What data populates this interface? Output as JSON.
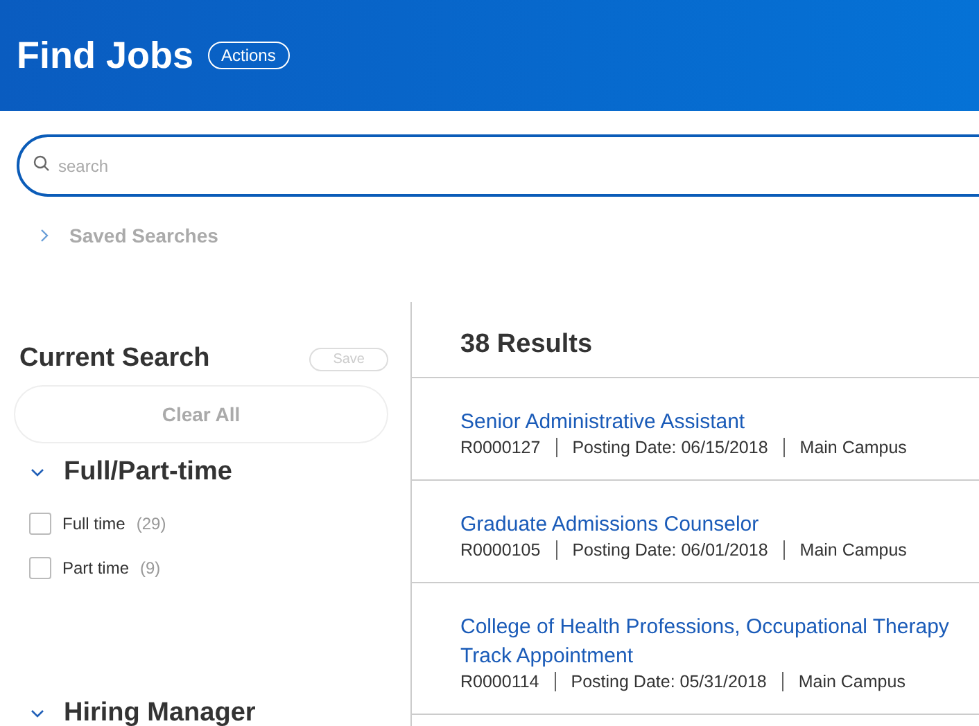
{
  "header": {
    "title": "Find Jobs",
    "actions_button": "Actions"
  },
  "search": {
    "placeholder": "search"
  },
  "saved_searches": {
    "label": "Saved Searches",
    "expanded": false
  },
  "current_search": {
    "title": "Current Search",
    "save_button": "Save",
    "clear_button": "Clear All"
  },
  "facets": [
    {
      "title": "Full/Part-time",
      "expanded": true,
      "options": [
        {
          "label": "Full time",
          "count": "(29)",
          "checked": false
        },
        {
          "label": "Part time",
          "count": "(9)",
          "checked": false
        }
      ]
    },
    {
      "title": "Hiring Manager",
      "expanded": true
    }
  ],
  "results": {
    "count": "38 Results",
    "jobs": [
      {
        "title": "Senior Administrative Assistant",
        "meta": [
          "R0000127",
          "Posting Date: 06/15/2018",
          "Main Campus"
        ]
      },
      {
        "title": "Graduate Admissions Counselor",
        "meta": [
          "R0000105",
          "Posting Date: 06/01/2018",
          "Main Campus"
        ]
      },
      {
        "title": "College of Health Professions, Occupational Therapy Track Appointment",
        "meta": [
          "R0000114",
          "Posting Date: 05/31/2018",
          "Main Campus"
        ]
      }
    ]
  }
}
